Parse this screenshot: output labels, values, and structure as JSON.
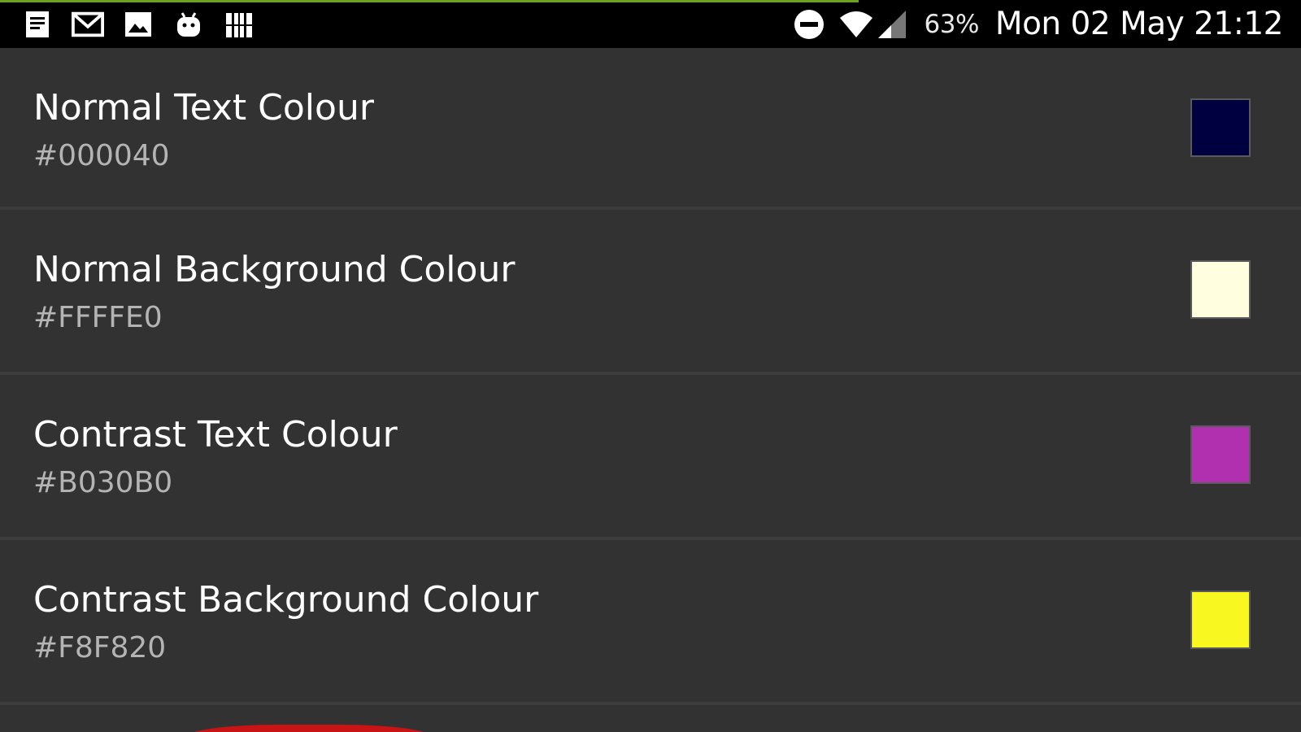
{
  "status_bar": {
    "notification_icons": [
      "notes-icon",
      "gmail-icon",
      "image-icon",
      "android-icon",
      "barcode-icon"
    ],
    "system_icons": [
      "do-not-disturb-icon",
      "wifi-icon",
      "cell-signal-icon"
    ],
    "battery": "63%",
    "datetime": "Mon 02 May 21:12",
    "progress": 0.66,
    "progress_color": "#6aa51c"
  },
  "preferences": [
    {
      "title": "Normal Text Colour",
      "value": "#000040",
      "swatch_color": "#000040"
    },
    {
      "title": "Normal Background Colour",
      "value": "#FFFFE0",
      "swatch_color": "#FFFFE0"
    },
    {
      "title": "Contrast Text Colour",
      "value": "#B030B0",
      "swatch_color": "#B030B0"
    },
    {
      "title": "Contrast Background Colour",
      "value": "#F8F820",
      "swatch_color": "#F8F820"
    }
  ],
  "colors": {
    "background": "#323232",
    "divider": "#3d3d3d",
    "status_bar": "#000000",
    "partial_button": "#c81414"
  }
}
